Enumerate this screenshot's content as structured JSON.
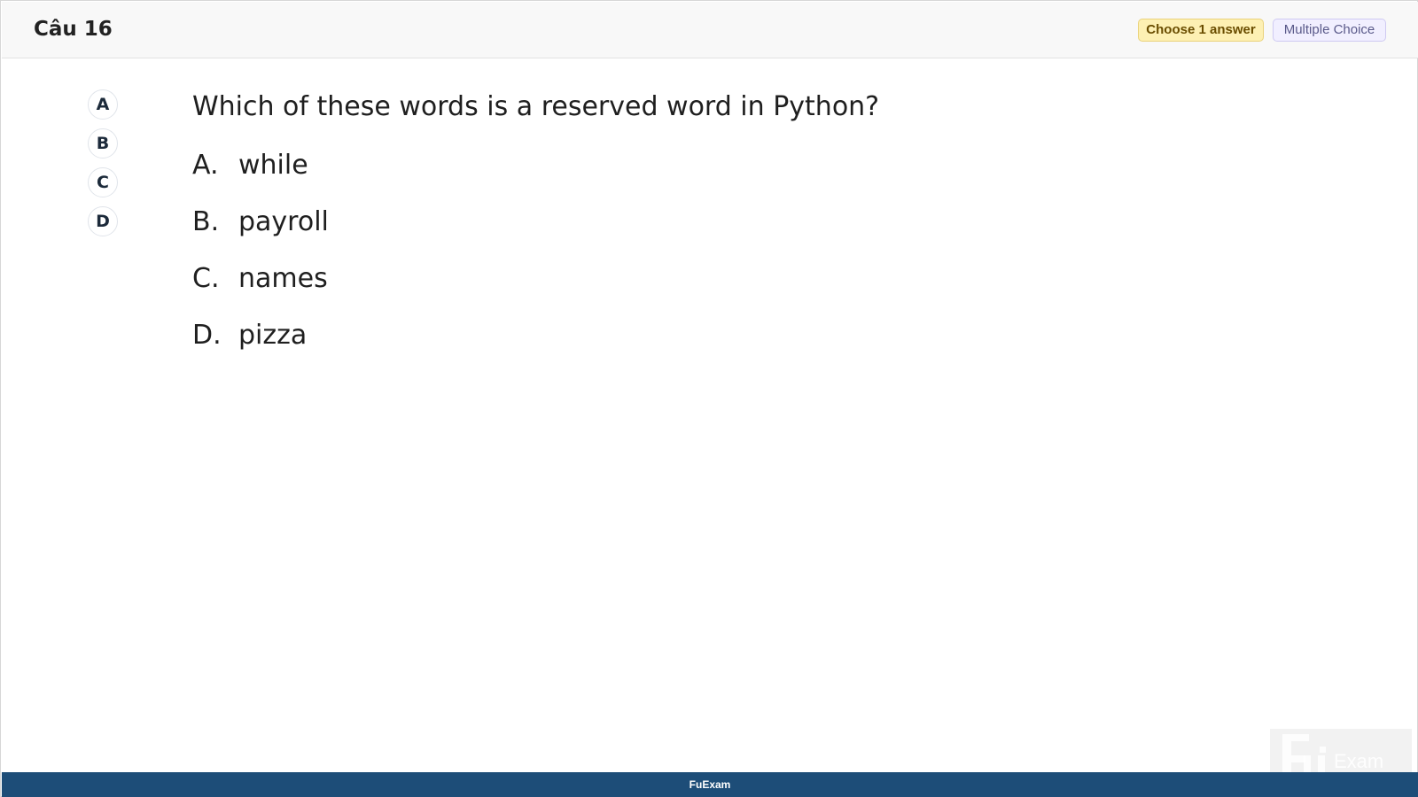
{
  "header": {
    "title": "Câu 16",
    "choose_badge": "Choose 1 answer",
    "type_badge": "Multiple Choice"
  },
  "bubbles": [
    "A",
    "B",
    "C",
    "D"
  ],
  "question": {
    "text": "Which of these words is a reserved word in Python?",
    "answers": [
      {
        "letter": "A.",
        "text": "while"
      },
      {
        "letter": "B.",
        "text": "payroll"
      },
      {
        "letter": "C.",
        "text": "names"
      },
      {
        "letter": "D.",
        "text": "pizza"
      }
    ]
  },
  "footer": {
    "label": "FuExam"
  },
  "watermark": {
    "text": "Exam"
  },
  "colors": {
    "footer_bg": "#1d4d78",
    "choose_badge_bg": "#fdf0b3",
    "type_badge_bg": "#f1efff"
  },
  "icons": {
    "watermark_logo": "fu-exam-logo-icon"
  }
}
